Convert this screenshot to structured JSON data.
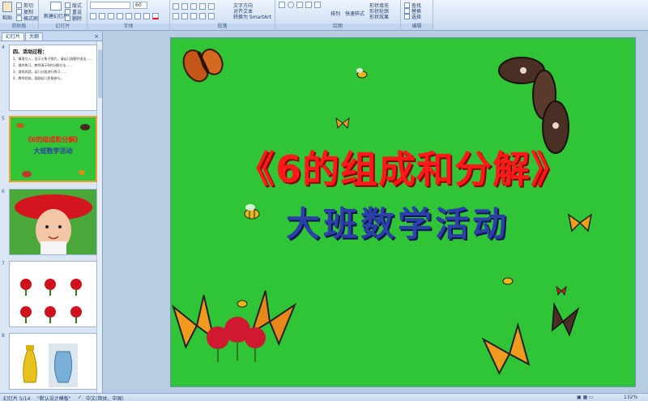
{
  "ribbon": {
    "groups": [
      {
        "label": "剪贴板",
        "buttons": [
          "粘贴",
          "剪切",
          "复制",
          "格式刷"
        ]
      },
      {
        "label": "幻灯片",
        "buttons": [
          "新建幻灯片",
          "版式",
          "重设",
          "删除"
        ]
      },
      {
        "label": "字体",
        "font_size": "60"
      },
      {
        "label": "段落",
        "buttons": [
          "文字方向",
          "对齐文本",
          "转换为 SmartArt"
        ]
      },
      {
        "label": "绘图",
        "buttons": [
          "排列",
          "快速样式",
          "形状填充",
          "形状轮廓",
          "形状效果"
        ]
      },
      {
        "label": "编辑",
        "buttons": [
          "查找",
          "替换",
          "选择"
        ]
      }
    ]
  },
  "panel": {
    "tabs": [
      "幻灯片",
      "大纲"
    ],
    "close": "×",
    "slides": [
      {
        "num": "4",
        "heading": "四、活动过程：",
        "lines": [
          "1、情境引入，出示小兔子图片，请幼儿观察并说出……",
          "2、操作练习，教师演示6的分解方法……",
          "3、游戏巩固，幼儿分组进行练习……",
          "4、教师总结，鼓励幼儿积极参与。"
        ]
      },
      {
        "num": "5",
        "title": "《6的组成和分解》",
        "subtitle": "大班数学活动"
      },
      {
        "num": "6"
      },
      {
        "num": "7"
      },
      {
        "num": "8"
      }
    ]
  },
  "slide": {
    "title": "《6的组成和分解》",
    "subtitle": "大班数学活动",
    "background": "#2fc536",
    "title_color": "#ff1a1a",
    "subtitle_color": "#2d3fa8"
  },
  "status": {
    "slide_info": "幻灯片 5/14",
    "theme": "\"默认设计模板\"",
    "language": "中文(简体，中国)",
    "zoom": "132%"
  }
}
